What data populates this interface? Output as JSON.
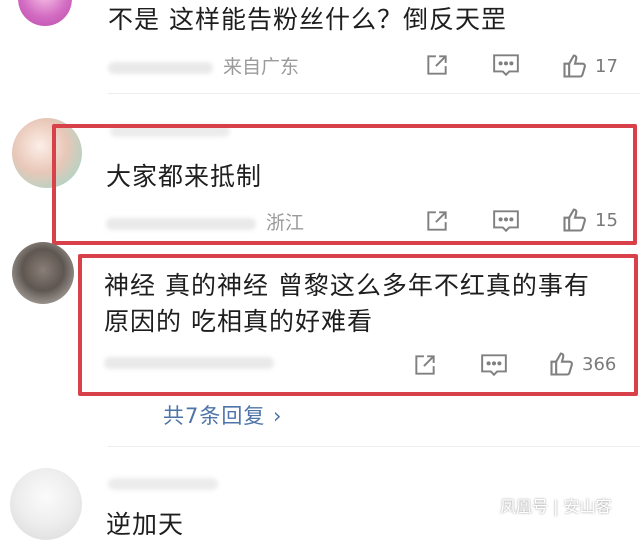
{
  "comments": [
    {
      "text": "不是 这样能告粉丝什么？倒反天罡",
      "location": "来自广东",
      "likes": "17"
    },
    {
      "text": "大家都来抵制",
      "location": "浙江",
      "likes": "15"
    },
    {
      "text_line1": "神经 真的神经 曾黎这么多年不红真的事有",
      "text_line2": "原因的 吃相真的好难看",
      "likes": "366"
    },
    {
      "text": "逆加天"
    }
  ],
  "replies": {
    "label": "共7条回复 ›"
  },
  "watermark": "凤凰号 | 安山客",
  "colors": {
    "highlight": "#d9414a",
    "link": "#4f74a8",
    "icon": "#808080"
  }
}
